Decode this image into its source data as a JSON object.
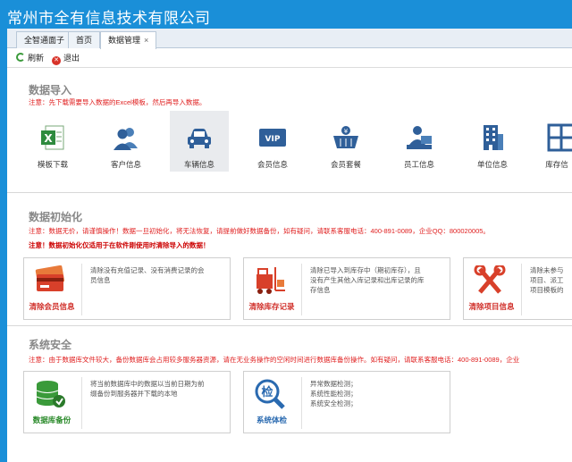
{
  "app": {
    "title": "常州市全有信息技术有限公司"
  },
  "tabs": [
    {
      "label": "全智通面子"
    },
    {
      "label": "首页"
    },
    {
      "label": "数据管理",
      "close": "×"
    }
  ],
  "toolbar": {
    "refresh": "刷新",
    "exit": "退出"
  },
  "import": {
    "title": "数据导入",
    "note": "注意：先下载需要导入数据的Excel模板，然后再导入数据。",
    "items": [
      {
        "label": "模板下载",
        "icon": "excel-icon"
      },
      {
        "label": "客户信息",
        "icon": "customers-icon"
      },
      {
        "label": "车辆信息",
        "icon": "car-icon"
      },
      {
        "label": "会员信息",
        "icon": "vip-card-icon"
      },
      {
        "label": "会员套餐",
        "icon": "basket-icon"
      },
      {
        "label": "员工信息",
        "icon": "employee-icon"
      },
      {
        "label": "单位信息",
        "icon": "building-icon"
      },
      {
        "label": "库存信",
        "icon": "inventory-grid-icon"
      }
    ]
  },
  "init": {
    "title": "数据初始化",
    "note": "注意：数据无价，请谨慎操作！数据一旦初始化，将无法恢复，请提前做好数据备份，如有疑问，请联系客服电话：400-891-0089，企业QQ：800020005。",
    "warning": "注意！数据初始化仅适用于在软件刚使用时清除导入的数据！",
    "cards": [
      {
        "label": "清除会员信息",
        "desc": [
          "清除没有充值记录、没有消费记录的会",
          "员信息"
        ],
        "icon": "credit-cards-icon"
      },
      {
        "label": "清除库存记录",
        "desc": [
          "清除已导入到库存中（期初库存），且",
          "没有产生其他入库记录和出库记录的库",
          "存信息"
        ],
        "icon": "forklift-icon"
      },
      {
        "label": "清除项目信息",
        "desc": [
          "清除未参与",
          "项目、派工",
          "项目模板的"
        ],
        "icon": "tools-icon"
      }
    ]
  },
  "security": {
    "title": "系统安全",
    "note": "注意：由于数据库文件较大，备份数据库会占用较多服务器资源，请在无业务操作的空闲时间进行数据库备份操作。如有疑问，请联系客服电话：400-891-0089，企业",
    "cards": [
      {
        "label": "数据库备份",
        "desc": [
          "将当前数据库中的数据以当前日期为前",
          "缀备份到服务器并下载的本地"
        ],
        "icon": "database-backup-icon"
      },
      {
        "label": "系统体检",
        "desc": [
          "异常数据检测；",
          "系统性能检测；",
          "系统安全检测；"
        ],
        "icon": "magnifier-check-icon",
        "glyph": "检"
      }
    ]
  },
  "colors": {
    "accent": "#1a8fd8",
    "warning": "#e02020"
  }
}
